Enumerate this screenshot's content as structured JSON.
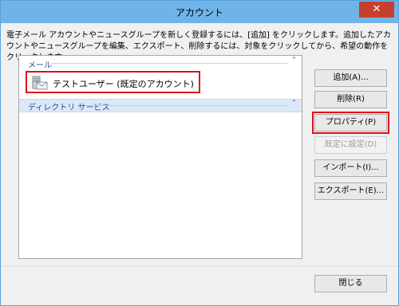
{
  "window": {
    "title": "アカウント",
    "close_glyph": "✕"
  },
  "instruction": "電子メール アカウントやニュースグループを新しく登録するには、[追加] をクリックします。追加したアカウントやニュースグループを編集、エクスポート、削除するには、対象をクリックしてから、希望の動作をクリックします。",
  "list": {
    "groups": [
      {
        "label": "メール",
        "chevron": "˄",
        "items": [
          {
            "label": "テストユーザー (既定のアカウント)",
            "icon": "mail-account-icon"
          }
        ]
      },
      {
        "label": "ディレクトリ サービス",
        "chevron": "˅"
      }
    ]
  },
  "buttons": {
    "add": "追加(A)...",
    "remove": "削除(R)",
    "properties": "プロパティ(P)",
    "set_default": "既定に設定(D)",
    "import": "インポート(I)...",
    "export": "エクスポート(E)...",
    "close": "閉じる"
  },
  "colors": {
    "titlebar": "#6fb4e8",
    "close_button": "#c7402f",
    "highlight": "#e0101a",
    "group_text": "#1f4e99"
  }
}
